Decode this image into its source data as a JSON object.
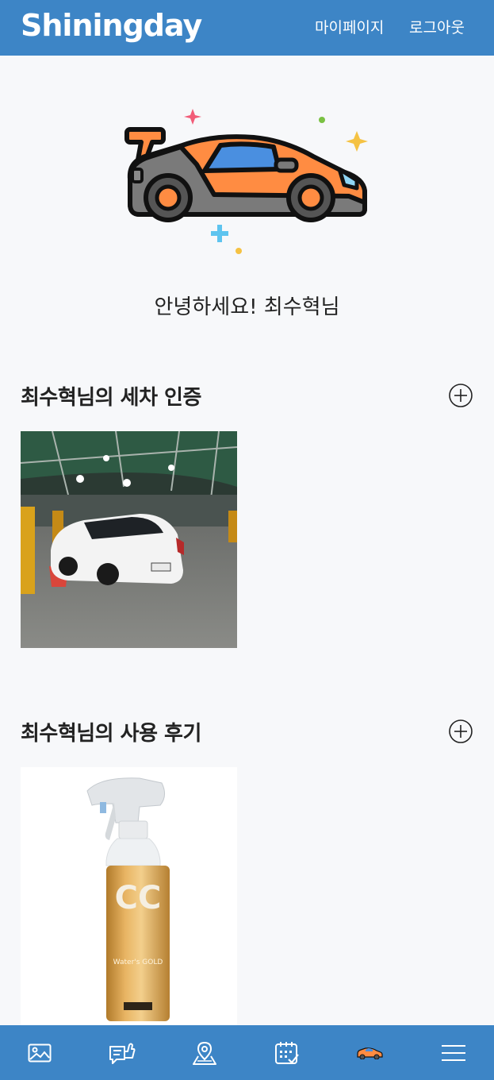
{
  "header": {
    "brand": "Shiningday",
    "mypage_label": "마이페이지",
    "logout_label": "로그아웃"
  },
  "greeting": "안녕하세요! 최수혁님",
  "sections": [
    {
      "title": "최수혁님의 세차 인증"
    },
    {
      "title": "최수혁님의 사용 후기"
    }
  ],
  "product": {
    "label_top": "CC",
    "label_brand": "Water's GOLD"
  },
  "bottom_nav": {
    "items": [
      "gallery-icon",
      "review-icon",
      "map-icon",
      "calendar-icon",
      "car-icon",
      "menu-icon"
    ]
  },
  "colors": {
    "primary": "#3d85c6",
    "background": "#f7f8fa",
    "car_orange": "#ff8c42"
  }
}
